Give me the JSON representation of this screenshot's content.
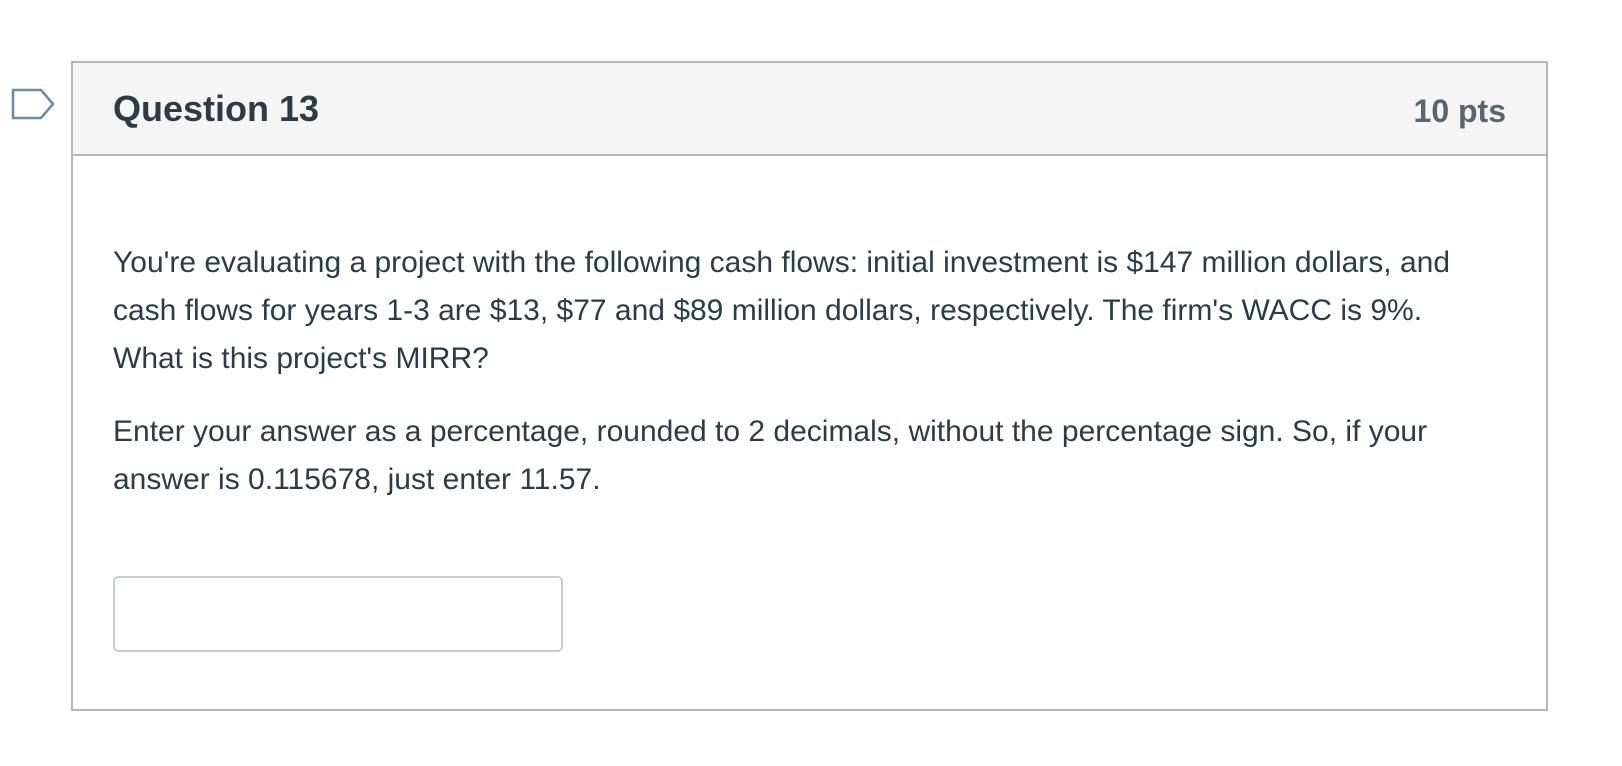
{
  "question": {
    "title": "Question 13",
    "points": "10 pts",
    "flag_icon": "flag-outline-icon",
    "paragraphs": [
      "You're evaluating a project with the following cash flows: initial investment is $147 million dollars, and cash flows for years 1-3 are $13, $77 and $89 million dollars, respectively. The firm's WACC is 9%. What is this project's MIRR?",
      "Enter your answer as a percentage, rounded to 2 decimals, without the percentage sign. So, if your answer is 0.115678, just enter 11.57."
    ],
    "answer": {
      "value": "",
      "placeholder": ""
    }
  },
  "colors": {
    "text": "#2d3b45",
    "header_bg": "#f5f5f5",
    "border": "#b3b6b8",
    "flag_stroke": "#6b8ba4"
  }
}
